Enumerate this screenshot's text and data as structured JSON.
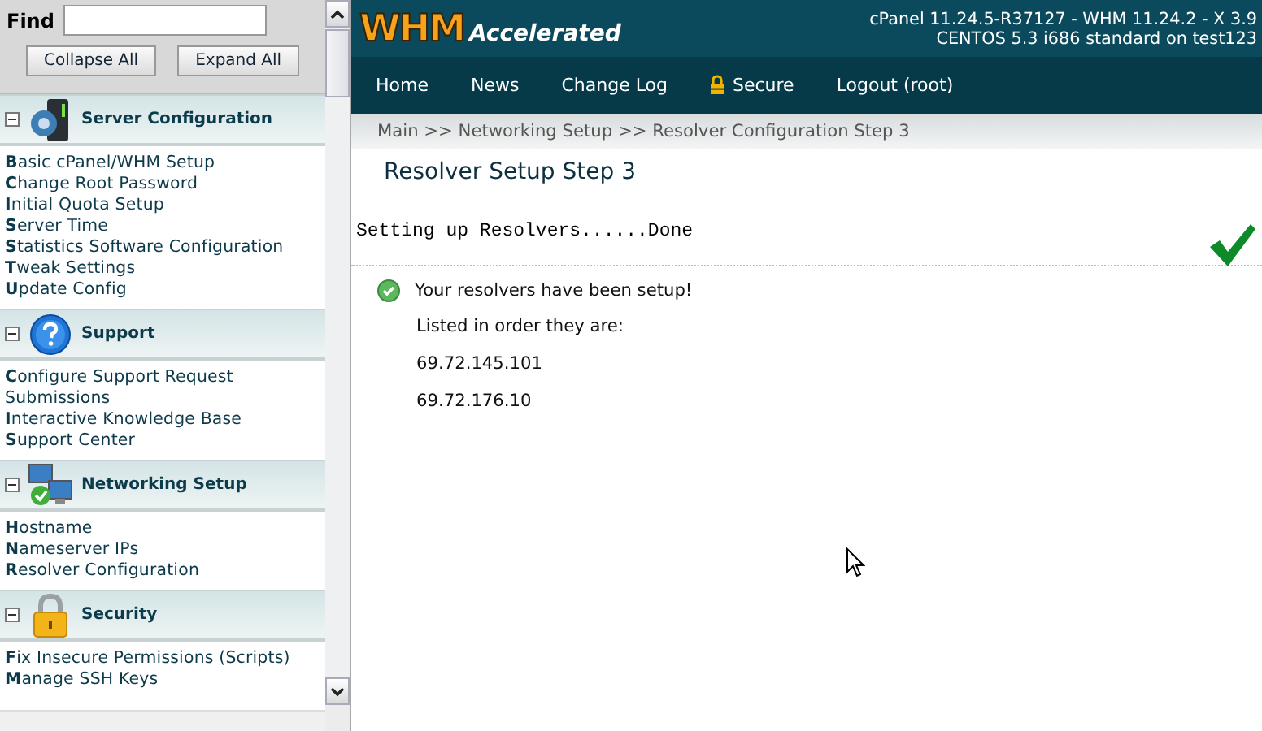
{
  "sidebar": {
    "find": {
      "label": "Find"
    },
    "buttons": [
      "Collapse All",
      "Expand All"
    ],
    "sections": [
      {
        "title": "Server Configuration",
        "expanded": true,
        "items": [
          "**B**asic cPanel/WHM Setup",
          "**C**hange Root Password",
          "**I**nitial Quota Setup",
          "**S**erver Time",
          "**S**tatistics Software Configuration",
          "**T**weak Settings",
          "**U**pdate Config"
        ]
      },
      {
        "title": "Support",
        "expanded": true,
        "items": [
          "**C**onfigure Support Request Submissions",
          "**I**nteractive Knowledge Base",
          "**S**upport Center"
        ]
      },
      {
        "title": "Networking Setup",
        "expanded": true,
        "items": [
          "**H**ostname",
          "**N**ameserver IPs",
          "**R**esolver Configuration"
        ]
      },
      {
        "title": "Security",
        "expanded": true,
        "items": [
          "**F**ix Insecure Permissions (Scripts)",
          "**M**anage SSH Keys"
        ]
      }
    ]
  },
  "header": {
    "logo_main": "WHM",
    "logo_sub": "Accelerated",
    "version_lines": [
      "cPanel 11.24.5-R37127 - WHM 11.24.2 - X 3.9",
      "CENTOS 5.3 i686 standard on test123"
    ]
  },
  "nav": [
    {
      "label": "Home",
      "kind": "plain"
    },
    {
      "label": "News",
      "kind": "plain"
    },
    {
      "label": "Change Log",
      "kind": "plain"
    },
    {
      "label": "Secure",
      "kind": "lock"
    },
    {
      "label": "Logout (root)",
      "kind": "plain"
    }
  ],
  "breadcrumb": "Main >> Networking Setup >> Resolver Configuration Step 3",
  "page_title": "Resolver Setup Step 3",
  "status_line": "Setting up Resolvers......Done",
  "result": {
    "message": "Your resolvers have been setup!",
    "intro": "Listed in order they are:",
    "resolvers": [
      "69.72.145.101",
      "69.72.176.10"
    ]
  }
}
